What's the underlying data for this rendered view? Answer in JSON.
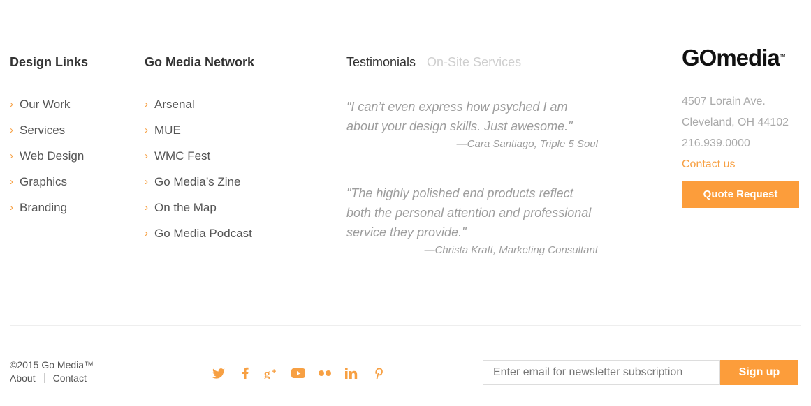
{
  "design_links": {
    "title": "Design Links",
    "items": [
      {
        "label": "Our Work"
      },
      {
        "label": "Services"
      },
      {
        "label": "Web Design"
      },
      {
        "label": "Graphics"
      },
      {
        "label": "Branding"
      }
    ]
  },
  "network": {
    "title": "Go Media Network",
    "items": [
      {
        "label": "Arsenal"
      },
      {
        "label": "MUE"
      },
      {
        "label": "WMC Fest"
      },
      {
        "label": "Go Media’s Zine"
      },
      {
        "label": "On the Map"
      },
      {
        "label": "Go Media Podcast"
      }
    ]
  },
  "testimonials": {
    "tabs": [
      {
        "label": "Testimonials",
        "active": true
      },
      {
        "label": "On-Site Services",
        "active": false
      }
    ],
    "quotes": [
      {
        "text": "\"I can’t even express how psyched I am about your design skills. Just awesome.\"",
        "author": "—Cara Santiago, Triple 5 Soul"
      },
      {
        "text": "\"The highly polished end products reflect both the personal attention and professional service they provide.\"",
        "author": "—Christa Kraft, Marketing Consultant"
      }
    ]
  },
  "contact": {
    "logo": "GOmedia",
    "logo_tm": "™",
    "address_line1": "4507 Lorain Ave.",
    "address_line2": "Cleveland, OH 44102",
    "phone": "216.939.0000",
    "contact_link": "Contact us",
    "quote_button": "Quote Request"
  },
  "footer": {
    "copyright": "©2015 Go Media™",
    "about": "About",
    "contact": "Contact",
    "social": [
      {
        "icon": "twitter-icon",
        "glyph": "🐦"
      },
      {
        "icon": "facebook-icon",
        "glyph": "f"
      },
      {
        "icon": "google-plus-icon",
        "glyph": "g+"
      },
      {
        "icon": "youtube-icon",
        "glyph": "▶"
      },
      {
        "icon": "flickr-icon",
        "glyph": "••"
      },
      {
        "icon": "linkedin-icon",
        "glyph": "in"
      },
      {
        "icon": "pinterest-icon",
        "glyph": "P"
      }
    ],
    "newsletter_placeholder": "Enter email for newsletter subscription",
    "signup_label": "Sign up"
  },
  "colors": {
    "accent": "#fc9d3b",
    "chevron": "#f7a043"
  }
}
